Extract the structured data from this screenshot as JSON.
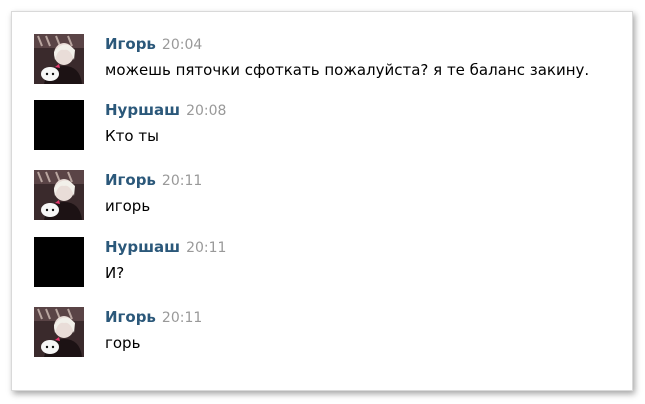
{
  "colors": {
    "author": "#2b587a",
    "time": "#999999",
    "text": "#000000",
    "background": "#ffffff"
  },
  "messages": [
    {
      "author": "Игорь",
      "time": "20:04",
      "text": "можешь пяточки сфоткать пожалуйста? я те баланс закину.",
      "avatar": "photo-avatar"
    },
    {
      "author": "Нуршаш",
      "time": "20:08",
      "text": "Кто ты",
      "avatar": "blacked-out-avatar"
    },
    {
      "author": "Игорь",
      "time": "20:11",
      "text": "игорь",
      "avatar": "photo-avatar"
    },
    {
      "author": "Нуршаш",
      "time": "20:11",
      "text": "И?",
      "avatar": "blacked-out-avatar"
    },
    {
      "author": "Игорь",
      "time": "20:11",
      "text": "горь",
      "avatar": "photo-avatar"
    }
  ]
}
